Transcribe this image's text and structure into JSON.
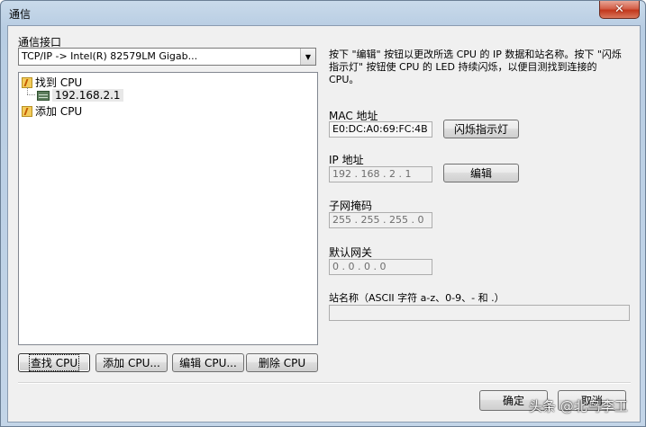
{
  "window": {
    "title": "通信",
    "close_glyph": "✕"
  },
  "interface": {
    "label": "通信接口",
    "selected": "TCP/IP -> Intel(R) 82579LM Gigab...",
    "arrow_glyph": "▼"
  },
  "tree": {
    "found_cpu_label": "找到 CPU",
    "found_cpu_ip": "192.168.2.1",
    "add_cpu_label": "添加 CPU"
  },
  "description": "按下 \"编辑\" 按钮以更改所选 CPU 的 IP 数据和站名称。按下 \"闪烁指示灯\" 按钮使 CPU 的 LED 持续闪烁，以便目测找到连接的 CPU。",
  "mac": {
    "label": "MAC 地址",
    "value": "E0:DC:A0:69:FC:4B",
    "flash_button": "闪烁指示灯"
  },
  "ip": {
    "label": "IP 地址",
    "value": "192 . 168 .  2  .  1",
    "edit_button": "编辑"
  },
  "subnet": {
    "label": "子网掩码",
    "value": "255 . 255 . 255 .  0"
  },
  "gateway": {
    "label": "默认网关",
    "value": " 0  .  0  .  0  .  0"
  },
  "station": {
    "label": "站名称（ASCII 字符 a-z、0-9、- 和 .）",
    "value": ""
  },
  "buttons": {
    "find_cpu": "查找 CPU",
    "add_cpu": "添加 CPU...",
    "edit_cpu": "编辑 CPU...",
    "delete_cpu": "删除 CPU",
    "ok": "确定",
    "cancel": "取消"
  },
  "watermark": "头条 @北鸟李工"
}
